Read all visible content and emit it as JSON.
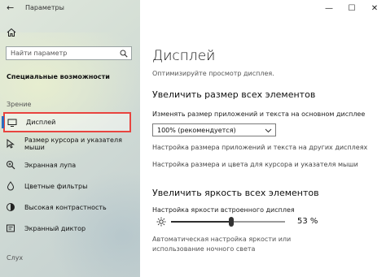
{
  "window": {
    "back_glyph": "←",
    "title": "Параметры",
    "minimize_glyph": "—",
    "maximize_glyph": "☐",
    "close_glyph": "✕"
  },
  "sidebar": {
    "home_icon": "home-icon",
    "search": {
      "placeholder": "Найти параметр",
      "icon": "search-icon"
    },
    "heading": "Специальные возможности",
    "group_vision": "Зрение",
    "items": [
      {
        "label": "Дисплей",
        "icon": "monitor-icon",
        "selected": true
      },
      {
        "label": "Размер курсора и указателя мыши",
        "icon": "cursor-icon",
        "selected": false
      },
      {
        "label": "Экранная лупа",
        "icon": "magnifier-icon",
        "selected": false
      },
      {
        "label": "Цветные фильтры",
        "icon": "color-filter-icon",
        "selected": false
      },
      {
        "label": "Высокая контрастность",
        "icon": "contrast-icon",
        "selected": false
      },
      {
        "label": "Экранный диктор",
        "icon": "narrator-icon",
        "selected": false
      }
    ],
    "group_hearing": "Слух",
    "accent_color": "#2a6cbf",
    "highlight_color": "#e8443f"
  },
  "main": {
    "title": "Дисплей",
    "subtitle": "Оптимизируйте просмотр дисплея.",
    "section_size": {
      "heading": "Увеличить размер всех элементов",
      "label": "Изменять размер приложений и текста на основном дисплее",
      "dropdown_value": "100% (рекомендуется)",
      "links": [
        "Настройка размера приложений и текста на других дисплеях",
        "Настройка размера и цвета для курсора и указателя мыши"
      ]
    },
    "section_brightness": {
      "heading": "Увеличить яркость всех элементов",
      "slider_label": "Настройка яркости встроенного дисплея",
      "value": 53,
      "value_text": "53 %",
      "auto_text": "Автоматическая настройка яркости или использование ночного света"
    }
  }
}
